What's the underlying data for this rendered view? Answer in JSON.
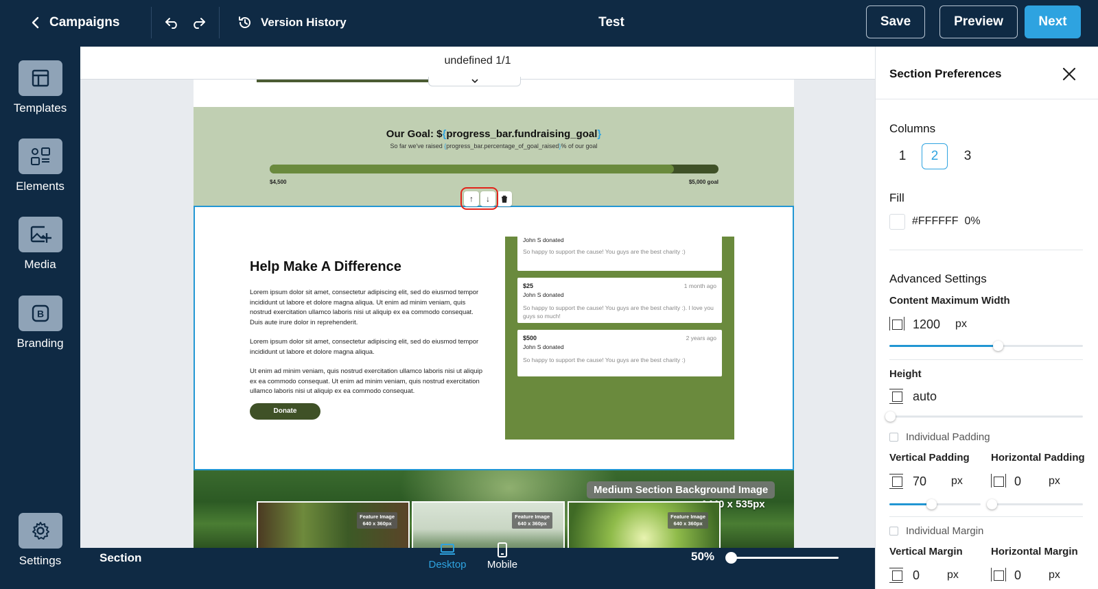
{
  "topbar": {
    "back_label": "Campaigns",
    "version_history_label": "Version History",
    "title": "Test",
    "save_label": "Save",
    "preview_label": "Preview",
    "next_label": "Next"
  },
  "sidebar": {
    "items": [
      {
        "label": "Templates",
        "icon": "layout-icon"
      },
      {
        "label": "Elements",
        "icon": "elements-icon"
      },
      {
        "label": "Media",
        "icon": "add-image-icon"
      },
      {
        "label": "Branding",
        "icon": "brand-icon"
      },
      {
        "label": "Settings",
        "icon": "gear-icon"
      }
    ]
  },
  "canvas": {
    "page_indicator": "undefined 1/1",
    "goal": {
      "title_prefix": "Our Goal: $",
      "title_open": "{",
      "title_var": "progress_bar.fundraising_goal",
      "title_close": "}",
      "sub_prefix": "So far we've raised ",
      "sub_open": "{",
      "sub_var": "progress_bar.percentage_of_goal_raised",
      "sub_close": "}",
      "sub_suffix": "% of our goal",
      "raised_label": "$4,500",
      "goal_label": "$5,000 goal",
      "progress_fraction": 0.9
    },
    "section_tools": {
      "up": "↑",
      "down": "↓"
    },
    "help": {
      "heading": "Help Make A Difference",
      "paragraphs": [
        "Lorem ipsum dolor sit amet, consectetur adipiscing elit, sed do eiusmod tempor incididunt ut labore et dolore magna aliqua. Ut enim ad minim veniam, quis nostrud exercitation ullamco laboris nisi ut aliquip ex ea commodo consequat. Duis aute irure dolor in reprehenderit.",
        "Lorem ipsum dolor sit amet, consectetur adipiscing elit, sed do eiusmod tempor incididunt ut labore et dolore magna aliqua.",
        "Ut enim ad minim veniam, quis nostrud exercitation ullamco laboris nisi ut aliquip ex ea commodo consequat. Ut enim ad minim veniam, quis nostrud exercitation ullamco laboris nisi ut aliquip ex ea commodo consequat."
      ],
      "donate_label": "Donate",
      "donations": [
        {
          "amount": "",
          "time": "",
          "donor": "John S donated",
          "message": "So happy to support the cause! You guys are the best charity :)"
        },
        {
          "amount": "$25",
          "time": "1 month ago",
          "donor": "John S donated",
          "message": "So happy to support the cause! You guys are the best charity :). I love you guys so much!"
        },
        {
          "amount": "$500",
          "time": "2 years ago",
          "donor": "John S donated",
          "message": "So happy to support the cause! You guys are the best charity :)"
        }
      ]
    },
    "media": {
      "bg_label_line1": "Medium Section Background Image",
      "bg_label_line2": "1440 x 535px",
      "feature_tag_line1": "Feature Image",
      "feature_tag_line2": "640 x 360px"
    }
  },
  "bottombar": {
    "section_label": "Section",
    "desktop_label": "Desktop",
    "mobile_label": "Mobile",
    "zoom_label": "50%",
    "zoom_fraction": 0
  },
  "panel": {
    "title": "Section Preferences",
    "columns_label": "Columns",
    "column_options": [
      "1",
      "2",
      "3"
    ],
    "selected_columns": "2",
    "fill_label": "Fill",
    "fill_value": "#FFFFFF",
    "fill_opacity": "0%",
    "advanced_label": "Advanced Settings",
    "content_max_width_label": "Content Maximum Width",
    "content_max_width_value": "1200",
    "content_max_width_unit": "px",
    "content_max_width_fraction": 0.56,
    "height_label": "Height",
    "height_value": "auto",
    "individual_padding_label": "Individual Padding",
    "vertical_padding_label": "Vertical Padding",
    "vertical_padding_value": "70",
    "horizontal_padding_label": "Horizontal Padding",
    "horizontal_padding_value": "0",
    "unit_px": "px",
    "vertical_padding_fraction": 0.46,
    "individual_margin_label": "Individual Margin",
    "vertical_margin_label": "Vertical Margin",
    "vertical_margin_value": "0",
    "horizontal_margin_label": "Horizontal Margin",
    "horizontal_margin_value": "0",
    "accent_color": "#2ea3e0"
  }
}
